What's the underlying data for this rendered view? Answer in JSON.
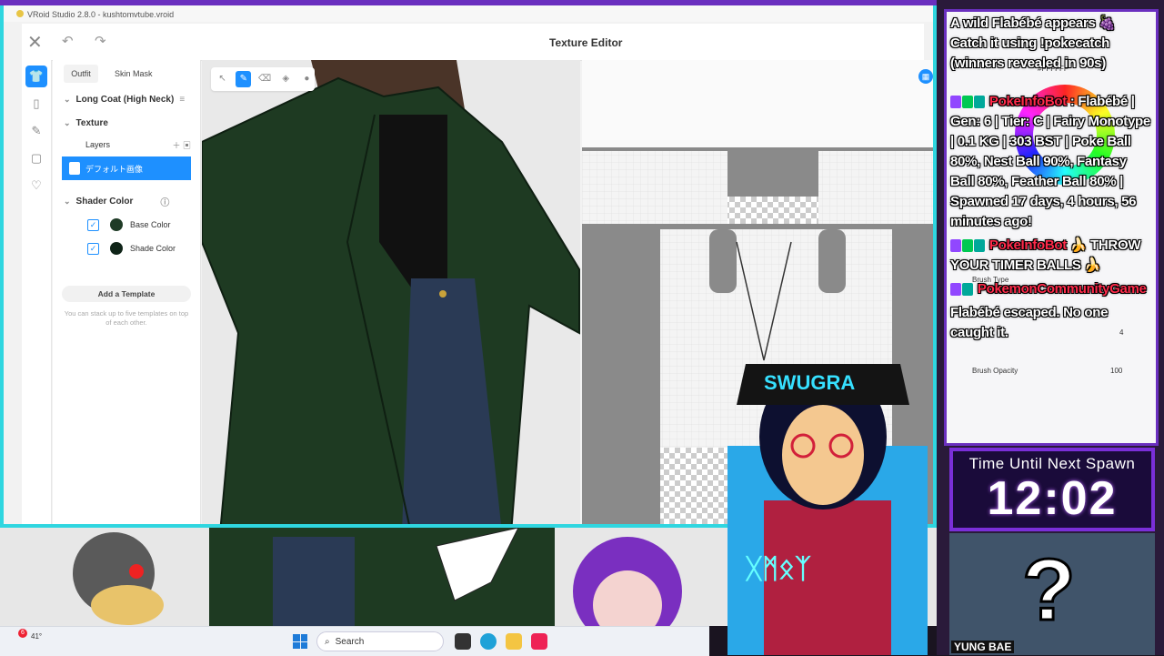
{
  "window": {
    "app_title": "VRoid Studio 2.8.0 - kushtomvtube.vroid",
    "editor_title": "Texture Editor"
  },
  "panel": {
    "tabs": [
      "Outfit",
      "Skin Mask"
    ],
    "item_title": "Long Coat (High Neck)",
    "texture_label": "Texture",
    "layers_label": "Layers",
    "layer_selected": "デフォルト画像",
    "shader_label": "Shader Color",
    "base_color_label": "Base Color",
    "shade_color_label": "Shade Color",
    "base_color": "#1f3b26",
    "shade_color": "#0f2418",
    "add_template": "Add a Template",
    "template_note": "You can stack up to five templates on top of each other."
  },
  "taskbar": {
    "search_placeholder": "Search",
    "weather_temp": "41°",
    "notif_count": "6"
  },
  "chat": {
    "line1": "A wild Flabébé appears 🍇 Catch it using !pokecatch (winners revealed in 90s)",
    "line2_user": "PokeInfoBot",
    "line2_text": ": Flabébé | Gen: 6 | Tier: C | Fairy Monotype | 0.1 KG | 303 BST | Poke Ball 80%, Nest Ball 90%, Fantasy Ball 80%, Feather Ball 80% | Spawned 17 days, 4 hours, 56 minutes ago!",
    "line3_user": "PokeInfoBot",
    "line3_text": "🍌 THROW YOUR TIMER BALLS 🍌",
    "line4_user": "PokemonCommunityGame",
    "line5": "Flabébé escaped. No one caught it.",
    "ghost_hex": "#FFFFFF",
    "ghost_brush_type": "Brush Type",
    "ghost_brush_opacity": "Brush Opacity",
    "ghost_opacity_value": "100",
    "ghost_size_value": "4"
  },
  "timer": {
    "label": "Time Until Next Spawn",
    "value": "12:02"
  },
  "mystery": {
    "caption": "YUNG BAE"
  },
  "colors": {
    "accent_blue": "#1e90ff",
    "frame_cyan": "#2fd6e0",
    "frame_purple": "#6a2fbf",
    "coat_green": "#1e3a22"
  }
}
